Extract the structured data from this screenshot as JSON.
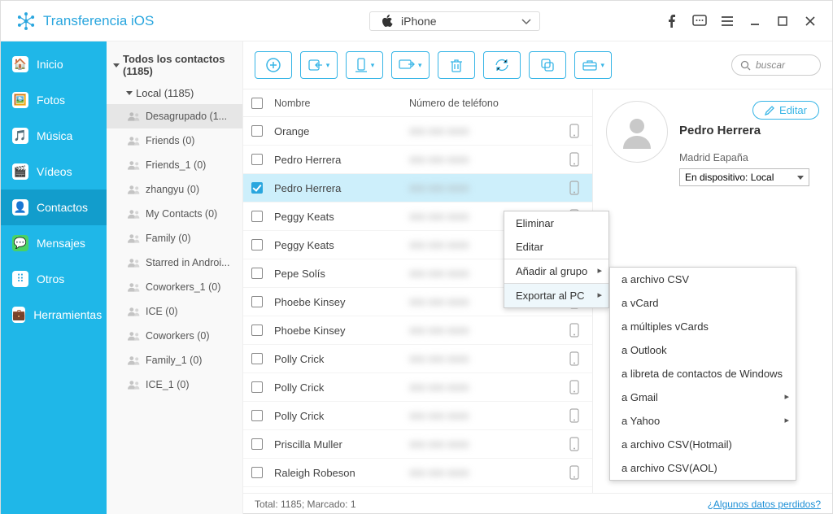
{
  "brand": "Transferencia iOS",
  "device": "iPhone",
  "search_placeholder": "buscar",
  "nav": [
    {
      "label": "Inicio",
      "key": "home"
    },
    {
      "label": "Fotos",
      "key": "photos"
    },
    {
      "label": "Música",
      "key": "music"
    },
    {
      "label": "Vídeos",
      "key": "videos"
    },
    {
      "label": "Contactos",
      "key": "contacts"
    },
    {
      "label": "Mensajes",
      "key": "messages"
    },
    {
      "label": "Otros",
      "key": "others"
    },
    {
      "label": "Herramientas",
      "key": "tools"
    }
  ],
  "nav_active": 4,
  "groups_header": "Todos los contactos  (1185)",
  "groups_local": "Local  (1185)",
  "groups": [
    {
      "label": "Desagrupado (1...",
      "selected": true
    },
    {
      "label": "Friends  (0)"
    },
    {
      "label": "Friends_1  (0)"
    },
    {
      "label": "zhangyu  (0)"
    },
    {
      "label": "My Contacts  (0)"
    },
    {
      "label": "Family  (0)"
    },
    {
      "label": "Starred in Androi..."
    },
    {
      "label": "Coworkers_1  (0)"
    },
    {
      "label": "ICE  (0)"
    },
    {
      "label": "Coworkers  (0)"
    },
    {
      "label": "Family_1  (0)"
    },
    {
      "label": "ICE_1  (0)"
    }
  ],
  "table": {
    "col_name": "Nombre",
    "col_phone": "Número de teléfono",
    "rows": [
      {
        "name": "Orange",
        "checked": false
      },
      {
        "name": "Pedro Herrera",
        "checked": false
      },
      {
        "name": "Pedro Herrera",
        "checked": true,
        "selected": true
      },
      {
        "name": "Peggy Keats",
        "checked": false
      },
      {
        "name": "Peggy Keats",
        "checked": false
      },
      {
        "name": "Pepe Solís",
        "checked": false
      },
      {
        "name": "Phoebe Kinsey",
        "checked": false
      },
      {
        "name": "Phoebe Kinsey",
        "checked": false
      },
      {
        "name": "Polly Crick",
        "checked": false
      },
      {
        "name": "Polly Crick",
        "checked": false
      },
      {
        "name": "Polly Crick",
        "checked": false
      },
      {
        "name": "Priscilla Muller",
        "checked": false
      },
      {
        "name": "Raleigh Robeson",
        "checked": false
      }
    ]
  },
  "details": {
    "edit": "Editar",
    "name": "Pedro Herrera",
    "location": "Madrid Eapaña",
    "storage": "En dispositivo: Local"
  },
  "context_menu": {
    "items": [
      "Eliminar",
      "Editar",
      "Añadir al grupo",
      "Exportar al PC"
    ],
    "submenu": [
      "a archivo CSV",
      "a vCard",
      "a múltiples vCards",
      "a Outlook",
      "a libreta de contactos de Windows",
      "a Gmail",
      "a Yahoo",
      "a archivo CSV(Hotmail)",
      "a archivo CSV(AOL)"
    ]
  },
  "footer": {
    "status": "Total: 1185; Marcado: 1",
    "link": "¿Algunos datos perdidos?"
  }
}
